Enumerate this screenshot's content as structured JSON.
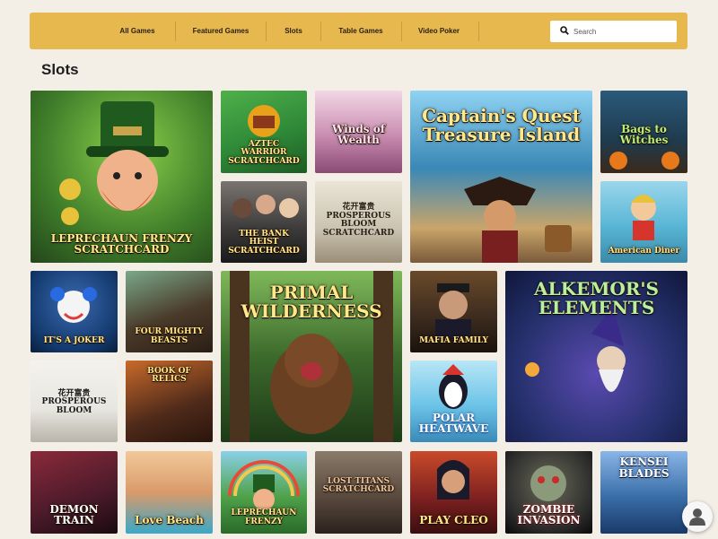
{
  "nav": {
    "items": [
      "All Games",
      "Featured Games",
      "Slots",
      "Table Games",
      "Video Poker"
    ]
  },
  "search": {
    "placeholder": "Search",
    "icon": "search-icon"
  },
  "page": {
    "title": "Slots"
  },
  "games": [
    {
      "title": "LEPRECHAUN FRENZY SCRATCHCARD",
      "color": "#3f7d2a",
      "accent": "#c93a2a"
    },
    {
      "title": "AZTEC WARRIOR SCRATCHCARD",
      "color": "#2f8a38",
      "accent": "#e8a21a"
    },
    {
      "title": "Winds of Wealth",
      "color": "#c98cb0",
      "accent": "#f4d3e3"
    },
    {
      "title": "Captain's Quest Treasure Island",
      "color": "#3a88b7",
      "accent": "#e6b84a"
    },
    {
      "title": "Bags to Witches",
      "color": "#1f3b4f",
      "accent": "#8fd14f"
    },
    {
      "title": "THE BANK HEIST SCRATCHCARD",
      "color": "#3b3a39",
      "accent": "#e2b043"
    },
    {
      "title": "花开富贵 PROSPEROUS BLOOM SCRATCHCARD",
      "color": "#c9c2b0",
      "accent": "#5a4a3a"
    },
    {
      "title": "American Diner",
      "color": "#59b6d6",
      "accent": "#d5352c"
    },
    {
      "title": "IT'S A JOKER",
      "color": "#143a6e",
      "accent": "#e23a3a"
    },
    {
      "title": "FOUR MIGHTY BEASTS",
      "color": "#4a3a2a",
      "accent": "#e1a33a"
    },
    {
      "title": "PRIMAL WILDERNESS",
      "color": "#3c6a2c",
      "accent": "#f2c94c"
    },
    {
      "title": "MAFIA FAMILY",
      "color": "#3a2a1e",
      "accent": "#d9b061"
    },
    {
      "title": "ALKEMOR'S ELEMENTS",
      "color": "#24306b",
      "accent": "#6fe07a"
    },
    {
      "title": "花开富贵 PROSPEROUS BLOOM",
      "color": "#e8e6e0",
      "accent": "#222222"
    },
    {
      "title": "BOOK OF RELICS",
      "color": "#4e2a1a",
      "accent": "#f0a030"
    },
    {
      "title": "POLAR HEATWAVE",
      "color": "#6cc4e8",
      "accent": "#ffffff"
    },
    {
      "title": "DEMON TRAIN",
      "color": "#4a1a2a",
      "accent": "#e63a3a"
    },
    {
      "title": "Love Beach",
      "color": "#d99a6a",
      "accent": "#ffe08a"
    },
    {
      "title": "LEPRECHAUN FRENZY",
      "color": "#4fa24a",
      "accent": "#f2d24a"
    },
    {
      "title": "LOST TITANS SCRATCHCARD",
      "color": "#5a4a3e",
      "accent": "#c9a074"
    },
    {
      "title": "PLAY CLEO",
      "color": "#7a1f1f",
      "accent": "#f2c94c"
    },
    {
      "title": "ZOMBIE INVASION",
      "color": "#2a2a2a",
      "accent": "#c92a2a"
    },
    {
      "title": "KENSEI BLADES",
      "color": "#3a6ea8",
      "accent": "#ffffff"
    }
  ],
  "help": {
    "icon": "user-help-icon"
  }
}
